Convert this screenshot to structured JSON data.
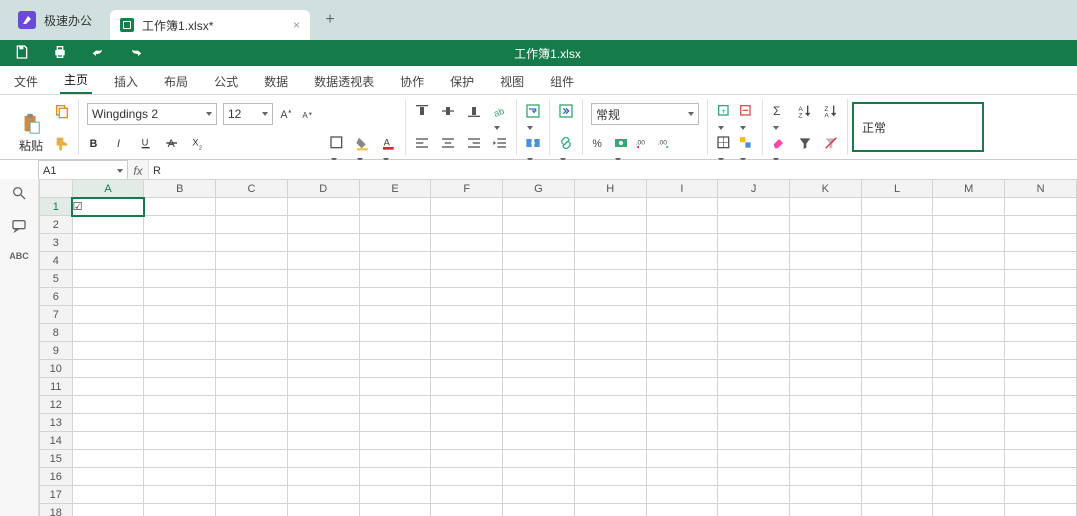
{
  "app": {
    "name": "极速办公"
  },
  "tab": {
    "label": "工作簿1.xlsx*",
    "close": "×",
    "add": "+"
  },
  "title": "工作簿1.xlsx",
  "menu": {
    "items": [
      "文件",
      "主页",
      "插入",
      "布局",
      "公式",
      "数据",
      "数据透视表",
      "协作",
      "保护",
      "视图",
      "组件"
    ],
    "activeIndex": 1
  },
  "ribbon": {
    "paste": "粘贴",
    "font": "Wingdings 2",
    "size": "12",
    "numfmt": "常规",
    "status": "正常"
  },
  "namebox": {
    "ref": "A1",
    "formula": "R"
  },
  "grid": {
    "cols": [
      "A",
      "B",
      "C",
      "D",
      "E",
      "F",
      "G",
      "H",
      "I",
      "J",
      "K",
      "L",
      "M",
      "N"
    ],
    "rows": 18,
    "activeCell": {
      "row": 1,
      "col": 0,
      "value": "☑"
    }
  },
  "side": {
    "spellcheck": "ABC"
  }
}
